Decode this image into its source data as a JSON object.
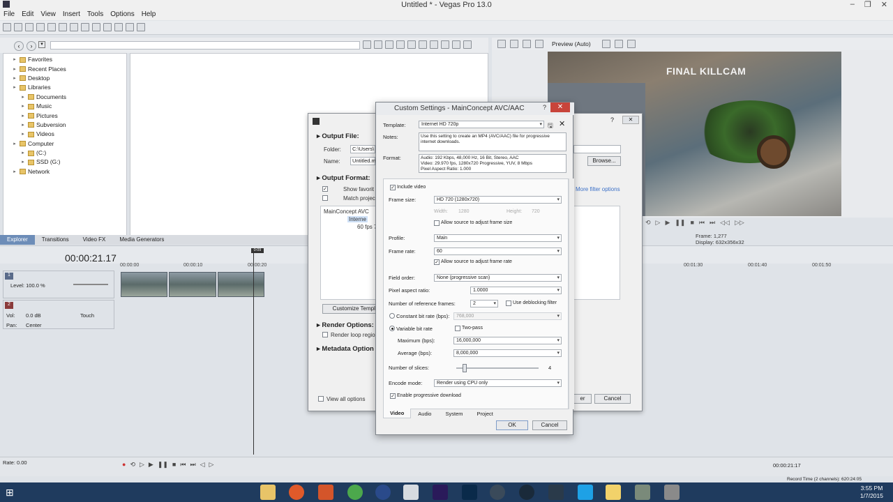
{
  "app": {
    "window_title": "Untitled * - Vegas Pro 13.0",
    "menu": [
      "File",
      "Edit",
      "View",
      "Insert",
      "Tools",
      "Options",
      "Help"
    ]
  },
  "explorer": {
    "tree": [
      {
        "label": "Favorites",
        "indent": 1
      },
      {
        "label": "Recent Places",
        "indent": 1
      },
      {
        "label": "Desktop",
        "indent": 1
      },
      {
        "label": "Libraries",
        "indent": 1
      },
      {
        "label": "Documents",
        "indent": 2
      },
      {
        "label": "Music",
        "indent": 2
      },
      {
        "label": "Pictures",
        "indent": 2
      },
      {
        "label": "Subversion",
        "indent": 2
      },
      {
        "label": "Videos",
        "indent": 2
      },
      {
        "label": "Computer",
        "indent": 1
      },
      {
        "label": "(C:)",
        "indent": 2
      },
      {
        "label": "SSD (G:)",
        "indent": 2
      },
      {
        "label": "Network",
        "indent": 1
      }
    ],
    "bottom_tabs": [
      "Explorer",
      "Transitions",
      "Video FX",
      "Media Generators"
    ]
  },
  "preview": {
    "quality": "Preview (Auto)",
    "overlay_text": "FINAL KILLCAM",
    "frame_label": "Frame:",
    "frame_value": "1,277",
    "display_label": "Display:",
    "display_value": "632x356x32"
  },
  "timeline": {
    "timecode": "00:00:21.17",
    "ruler": [
      "00:00:00",
      "00:00:10",
      "00:00:20",
      "00:01:30",
      "00:01:40",
      "00:01:50"
    ],
    "loop_marker": "0:09",
    "video_track": {
      "number": "1",
      "level": "Level: 100.0 %"
    },
    "audio_track": {
      "number": "2",
      "vol_label": "Vol:",
      "vol": "0.0 dB",
      "pan_label": "Pan:",
      "pan": "Center",
      "mode": "Touch"
    },
    "rate": "Rate: 0.00",
    "cursor_time": "00:00:21:17",
    "record_time": "Record Time (2 channels): 620:24:05"
  },
  "render_dialog": {
    "output_file": "Output File:",
    "folder_label": "Folder:",
    "folder_value": "C:\\Users\\",
    "name_label": "Name:",
    "name_value": "Untitled.m",
    "browse": "Browse...",
    "output_format": "Output Format:",
    "show_favorites": "Show favorit",
    "match_project": "Match projec",
    "format_item": "MainConcept AVC",
    "format_sub1": "Interne",
    "format_sub2": "60 fps 7",
    "more_filter": "More filter options",
    "customize": "Customize Templa",
    "render_options": "Render Options:",
    "render_loop": "Render loop regio",
    "metadata_options": "Metadata Option",
    "view_all": "View all options",
    "render_btn_partial": "er",
    "cancel": "Cancel"
  },
  "custom_settings": {
    "title": "Custom Settings - MainConcept AVC/AAC",
    "help": "?",
    "template_label": "Template:",
    "template_value": "Internet HD 720p",
    "notes_label": "Notes:",
    "notes_value": "Use this setting to create an MP4 (AVC/AAC) file for progressive internet downloads.",
    "format_label": "Format:",
    "format_value": "Audio: 192 Kbps, 48,000 Hz, 16 Bit, Stereo, AAC\nVideo: 29.970 fps, 1280x720 Progressive, YUV, 8 Mbps\nPixel Aspect Ratio: 1.000",
    "include_video": "Include video",
    "frame_size_label": "Frame size:",
    "frame_size_value": "HD 720 (1280x720)",
    "width_label": "Width:",
    "width_value": "1280",
    "height_label": "Height:",
    "height_value": "720",
    "allow_frame_size": "Allow source to adjust frame size",
    "profile_label": "Profile:",
    "profile_value": "Main",
    "frame_rate_label": "Frame rate:",
    "frame_rate_value": "60",
    "allow_frame_rate": "Allow source to adjust frame rate",
    "field_order_label": "Field order:",
    "field_order_value": "None (progressive scan)",
    "par_label": "Pixel aspect ratio:",
    "par_value": "1.0000",
    "ref_frames_label": "Number of reference frames:",
    "ref_frames_value": "2",
    "deblocking": "Use deblocking filter",
    "cbr_label": "Constant bit rate (bps):",
    "cbr_value": "768,000",
    "vbr_label": "Variable bit rate",
    "two_pass": "Two-pass",
    "max_label": "Maximum (bps):",
    "max_value": "16,000,000",
    "avg_label": "Average (bps):",
    "avg_value": "8,000,000",
    "slices_label": "Number of slices:",
    "slices_value": "4",
    "slices_level": 0.08,
    "encode_label": "Encode mode:",
    "encode_value": "Render using CPU only",
    "progressive": "Enable progressive download",
    "tabs": [
      "Video",
      "Audio",
      "System",
      "Project"
    ],
    "ok": "OK",
    "cancel": "Cancel"
  },
  "taskbar": {
    "time": "3:55 PM",
    "date": "1/7/2015"
  }
}
